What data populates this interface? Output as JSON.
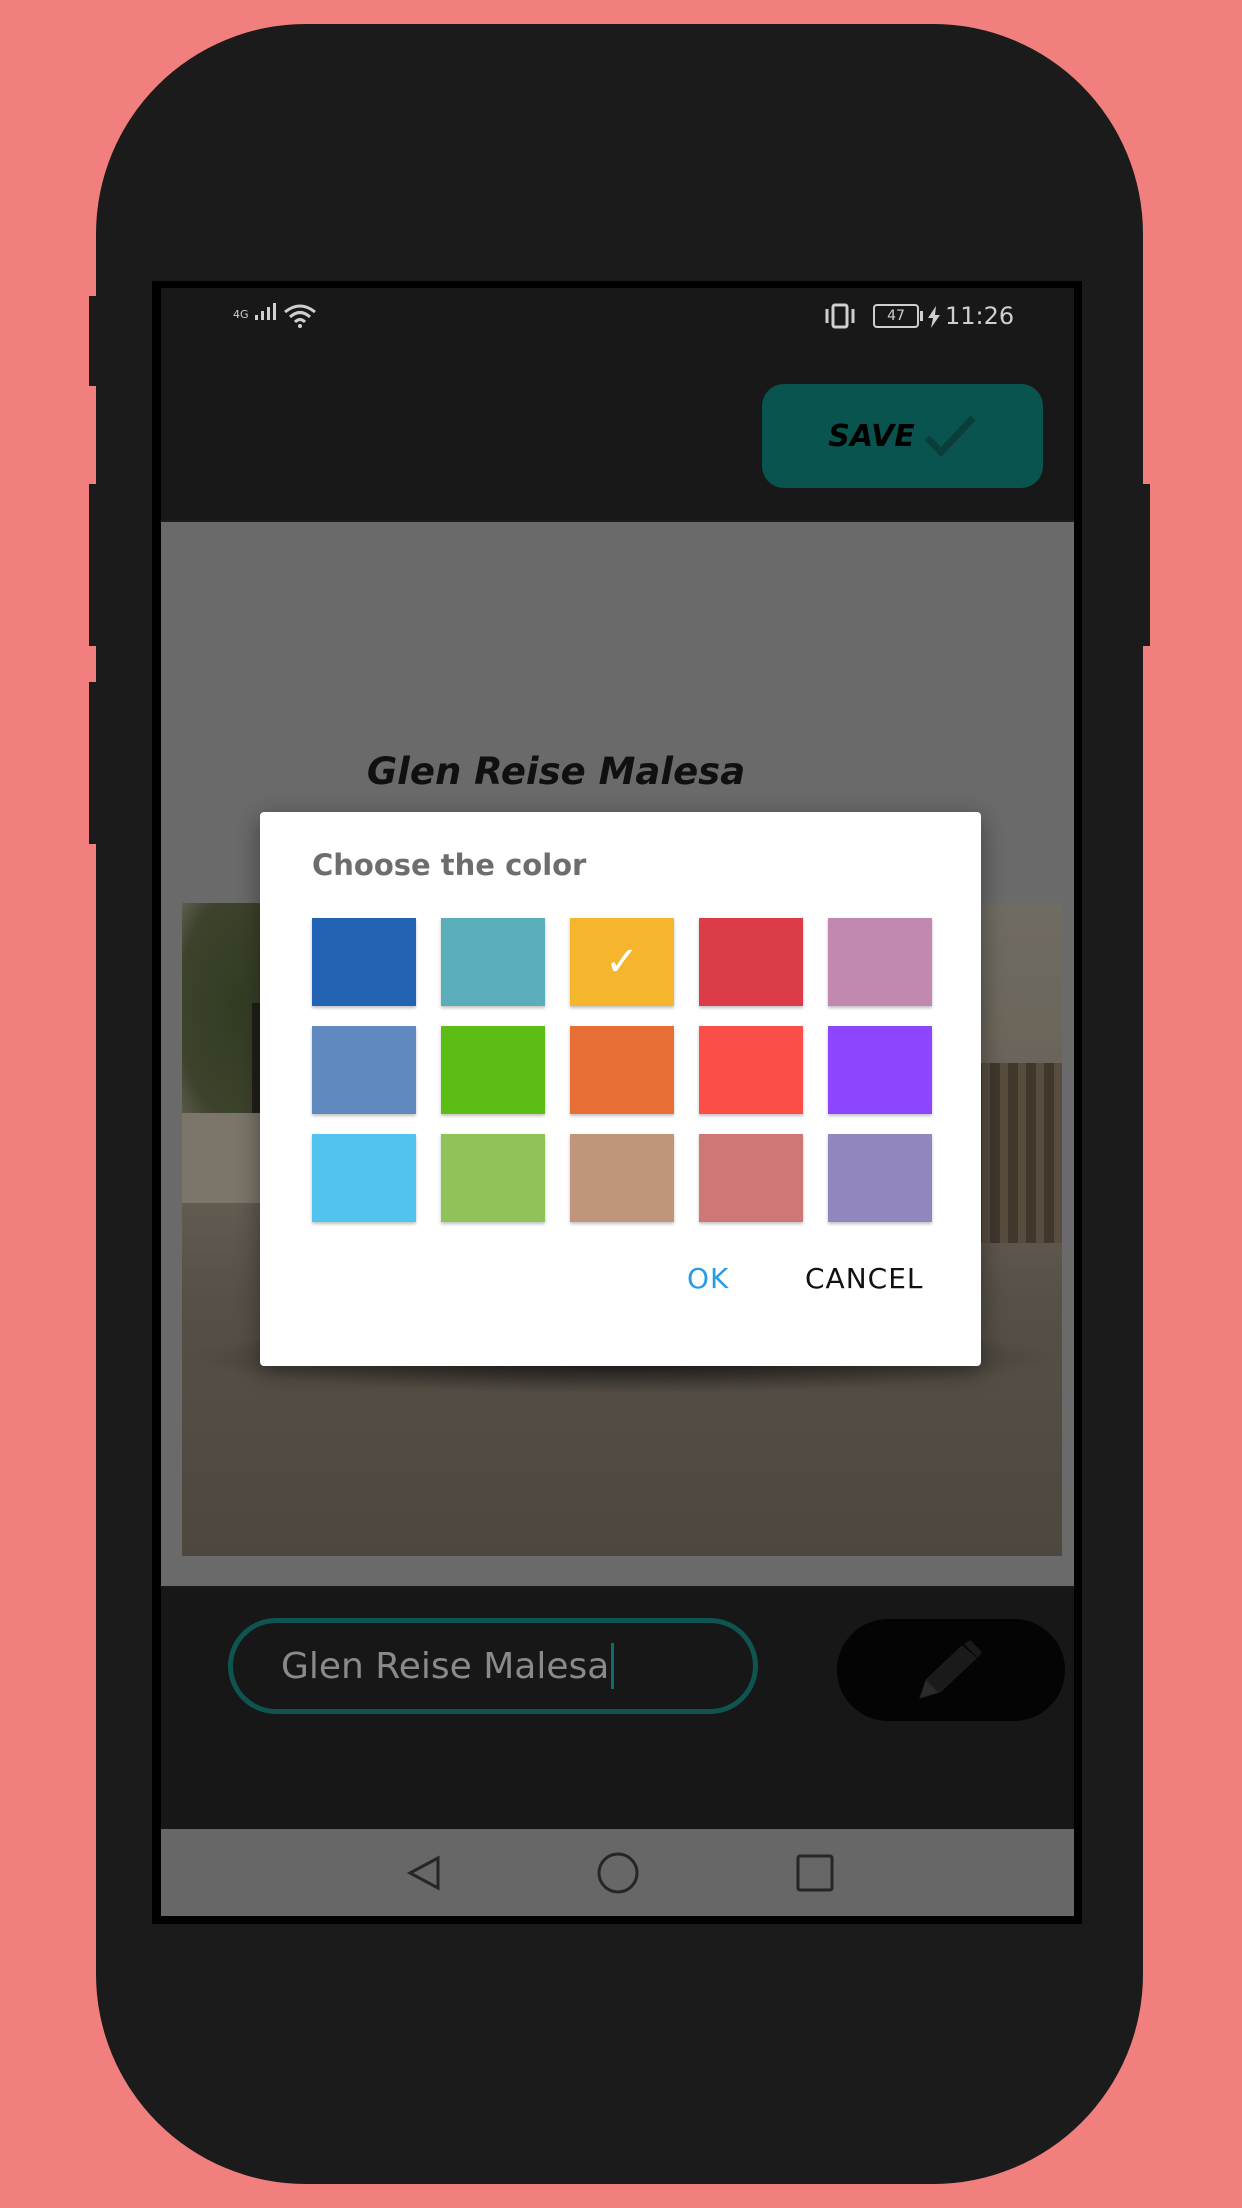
{
  "status_bar": {
    "network_label": "4G",
    "battery_level": "47",
    "time": "11:26",
    "icons": [
      "signal-icon",
      "wifi-icon",
      "vibrate-icon",
      "battery-icon",
      "charging-icon"
    ]
  },
  "toolbar": {
    "save_label": "SAVE",
    "save_icon": "check-icon",
    "save_color": "#0a5450"
  },
  "preview": {
    "name_text": "Glen Reise Malesa"
  },
  "editor": {
    "name_value": "Glen Reise Malesa",
    "edit_icon": "pencil-icon"
  },
  "nav": {
    "icons": [
      "back-icon",
      "home-icon",
      "recents-icon"
    ]
  },
  "dialog": {
    "title": "Choose the color",
    "selected_index": 2,
    "colors": [
      "#2363b3",
      "#59aeb9",
      "#f5b52c",
      "#dc3c47",
      "#c189b0",
      "#5f89bf",
      "#5cbe14",
      "#e76e34",
      "#fb4e48",
      "#8c46fd",
      "#50c3ef",
      "#8fc35a",
      "#c1957c",
      "#cf7676",
      "#9186be"
    ],
    "ok_label": "OK",
    "cancel_label": "CANCEL",
    "ok_color": "#2b9be6"
  }
}
